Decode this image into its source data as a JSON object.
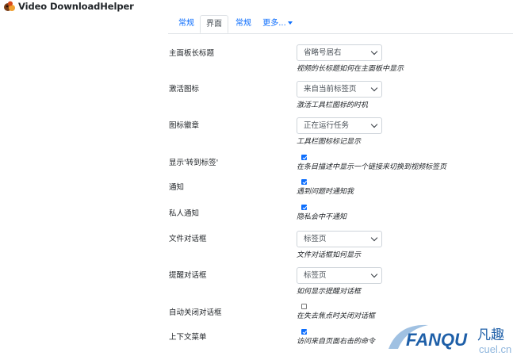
{
  "app": {
    "title": "Video DownloadHelper"
  },
  "tabs": [
    {
      "label": "常规",
      "active": false
    },
    {
      "label": "界面",
      "active": true
    },
    {
      "label": "常规",
      "active": false
    },
    {
      "label": "更多...",
      "active": false,
      "dropdown": true
    }
  ],
  "settings": {
    "title_position": {
      "label": "主面板长标题",
      "value": "省略号居右",
      "help": "视频的长标题如何在主面板中显示"
    },
    "activate_icon": {
      "label": "激活图标",
      "value": "来自当前标签页",
      "help": "激活工具栏图标的时机"
    },
    "icon_badge": {
      "label": "图标徽章",
      "value": "正在运行任务",
      "help": "工具栏图标标记显示"
    },
    "show_goto_tab": {
      "label": "显示'转到标签'",
      "checked": true,
      "help": "在条目描述中显示一个链接来切换到视频标签页"
    },
    "notifications": {
      "label": "通知",
      "checked": true,
      "help": "遇到问题时通知我"
    },
    "private_notifications": {
      "label": "私人通知",
      "checked": true,
      "help": "隐私会中不通知"
    },
    "file_dialog": {
      "label": "文件对话框",
      "value": "标签页",
      "help": "文件对话框如何显示"
    },
    "alert_dialog": {
      "label": "提醒对话框",
      "value": "标签页",
      "help": "如何显示提醒对话框"
    },
    "auto_close_dialog": {
      "label": "自动关闭对话框",
      "checked": false,
      "help": "在失去焦点时关闭对话框"
    },
    "context_menu": {
      "label": "上下文菜单",
      "checked": true,
      "help": "访问来自页面右击的命令"
    }
  },
  "watermark": {
    "brand": "FANQU",
    "brand_cn": "凡趣",
    "domain": "cuel.cn"
  },
  "colors": {
    "accent": "#0d6efd",
    "watermark_blue": "#1e5fa8",
    "watermark_light": "#8fb6dd"
  }
}
